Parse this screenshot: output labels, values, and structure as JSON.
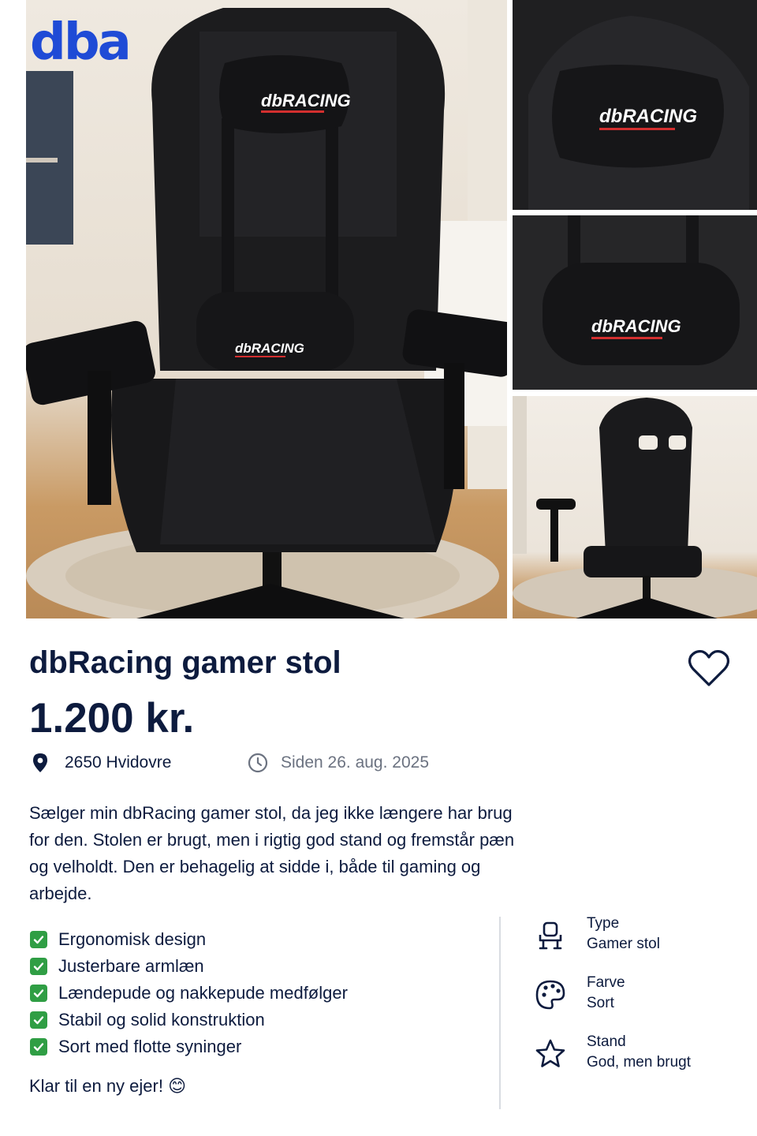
{
  "brand": {
    "logo_text": "dba",
    "color": "#1f4bd6"
  },
  "gallery": {
    "main_alt": "dbRacing gamer stol",
    "chair_brand_text": "dbRacing",
    "thumbnails": [
      "headrest",
      "lumbar-pillow",
      "back-view"
    ]
  },
  "listing": {
    "title": "dbRacing gamer stol",
    "price": "1.200 kr.",
    "location": "2650 Hvidovre",
    "posted": "Siden 26. aug. 2025",
    "description": "Sælger min dbRacing gamer stol, da jeg ikke længere har brug for den. Stolen er brugt, men i rigtig god stand og fremstår pæn og velholdt. Den er behagelig at sidde i, både til gaming og arbejde.",
    "features": [
      "Ergonomisk design",
      "Justerbare armlæn",
      "Lændepude og nakkepude medfølger",
      "Stabil og solid konstruktion",
      "Sort med flotte syninger"
    ],
    "closing": "Klar til en ny ejer! 😊"
  },
  "specs": [
    {
      "label": "Type",
      "value": "Gamer stol",
      "icon": "chair-icon"
    },
    {
      "label": "Farve",
      "value": "Sort",
      "icon": "palette-icon"
    },
    {
      "label": "Stand",
      "value": "God, men brugt",
      "icon": "star-icon"
    }
  ],
  "colors": {
    "text": "#0d1b3e",
    "muted": "#6b7280",
    "check": "#2f9e44",
    "accent_red": "#d32f2f"
  }
}
